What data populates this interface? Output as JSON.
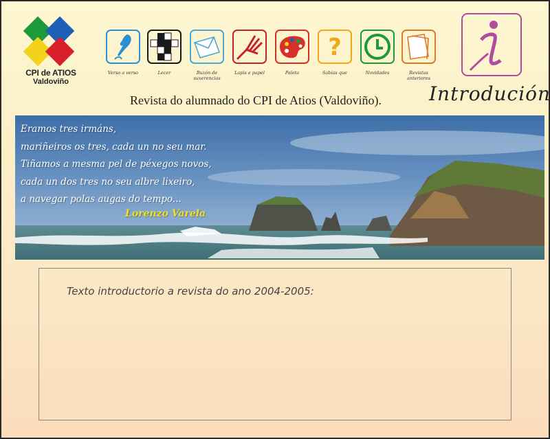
{
  "logo": {
    "title": "CPI de ATIOS",
    "subtitle": "Valdoviño"
  },
  "nav": [
    {
      "label": "Verso a verso",
      "icon": "quill-icon",
      "color": "#2a8fd4"
    },
    {
      "label": "Lecer",
      "icon": "crossword-icon",
      "color": "#1a1a1a"
    },
    {
      "label": "Buzón de suxerencias",
      "icon": "envelope-icon",
      "color": "#4aa8d8"
    },
    {
      "label": "Lapis e papel",
      "icon": "pen-paper-icon",
      "color": "#c8202a"
    },
    {
      "label": "Paleta",
      "icon": "palette-icon",
      "color": "#d83028"
    },
    {
      "label": "Sabías que",
      "icon": "question-icon",
      "color": "#f0a818"
    },
    {
      "label": "Novidades",
      "icon": "clock-icon",
      "color": "#1c9a3a"
    },
    {
      "label": "Revistas anteriores",
      "icon": "pages-icon",
      "color": "#e07828"
    }
  ],
  "intro": {
    "title": "Introdución",
    "icon": "info-icon"
  },
  "subtitle": "Revista do alumnado do CPI de Atios (Valdoviño).",
  "banner": {
    "poem": [
      "Eramos tres irmáns,",
      "mariñeiros os tres, cada un no seu mar.",
      "Tiñamos a mesma pel de péxegos novos,",
      "cada un dos tres no seu albre lixeiro,",
      "a navegar polas augas do tempo..."
    ],
    "author": "Lorenzo Varela"
  },
  "content": {
    "text": "Texto introductorio a revista do ano 2004-2005:"
  }
}
